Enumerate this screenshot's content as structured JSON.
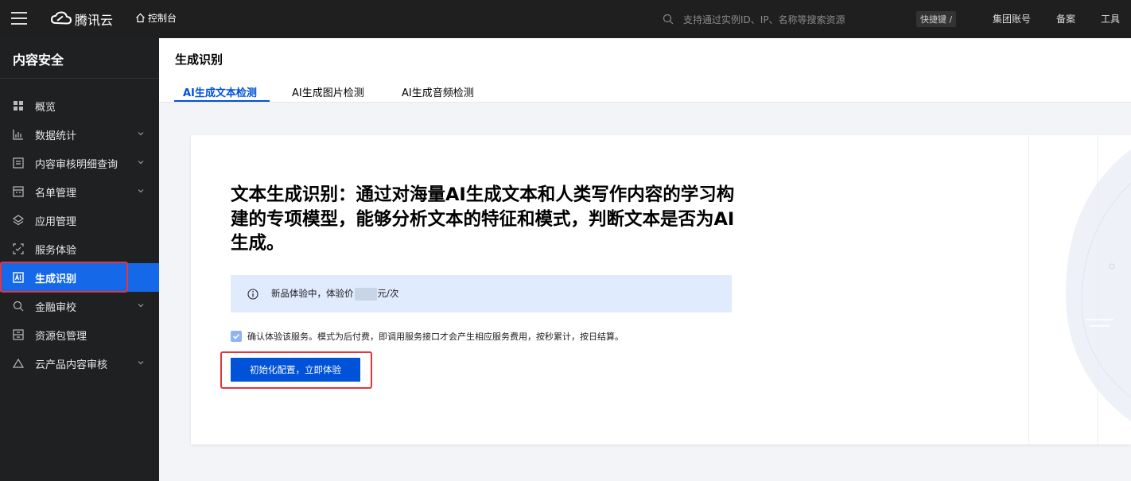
{
  "topbar": {
    "brand": "腾讯云",
    "console": "控制台",
    "search_placeholder": "支持通过实例ID、IP、名称等搜索资源",
    "shortcut": "快捷键 /",
    "links": [
      "集团账号",
      "备案",
      "工具"
    ]
  },
  "sidebar": {
    "title": "内容安全",
    "items": [
      {
        "label": "概览",
        "icon": "grid-icon",
        "expandable": false
      },
      {
        "label": "数据统计",
        "icon": "bar-chart-icon",
        "expandable": true
      },
      {
        "label": "内容审核明细查询",
        "icon": "list-icon",
        "expandable": true
      },
      {
        "label": "名单管理",
        "icon": "roster-icon",
        "expandable": true
      },
      {
        "label": "应用管理",
        "icon": "layers-icon",
        "expandable": false
      },
      {
        "label": "服务体验",
        "icon": "scan-icon",
        "expandable": false
      },
      {
        "label": "生成识别",
        "icon": "ai-icon",
        "expandable": false,
        "active": true
      },
      {
        "label": "金融审校",
        "icon": "finance-search-icon",
        "expandable": true
      },
      {
        "label": "资源包管理",
        "icon": "package-icon",
        "expandable": false
      },
      {
        "label": "云产品内容审核",
        "icon": "cloud-icon",
        "expandable": true
      }
    ]
  },
  "page": {
    "title": "生成识别",
    "tabs": [
      "AI生成文本检测",
      "AI生成图片检测",
      "AI生成音频检测"
    ],
    "active_tab": 0
  },
  "card": {
    "headline": "文本生成识别：通过对海量AI生成文本和人类写作内容的学习构建的专项模型，能够分析文本的特征和模式，判断文本是否为AI生成。",
    "info_prefix": "新品体验中，体验价",
    "info_suffix": "元/次",
    "consent": "确认体验该服务。模式为后付费，即调用服务接口才会产生相应服务费用，按秒累计，按日结算。",
    "consent_checked": true,
    "cta": "初始化配置，立即体验"
  },
  "colors": {
    "topbar": "#1f1f1f",
    "sidebar": "#1f2021",
    "active": "#1569e8",
    "primary": "#0052d9",
    "highlight": "#e5343a",
    "info_bg": "#e1ebfe"
  }
}
